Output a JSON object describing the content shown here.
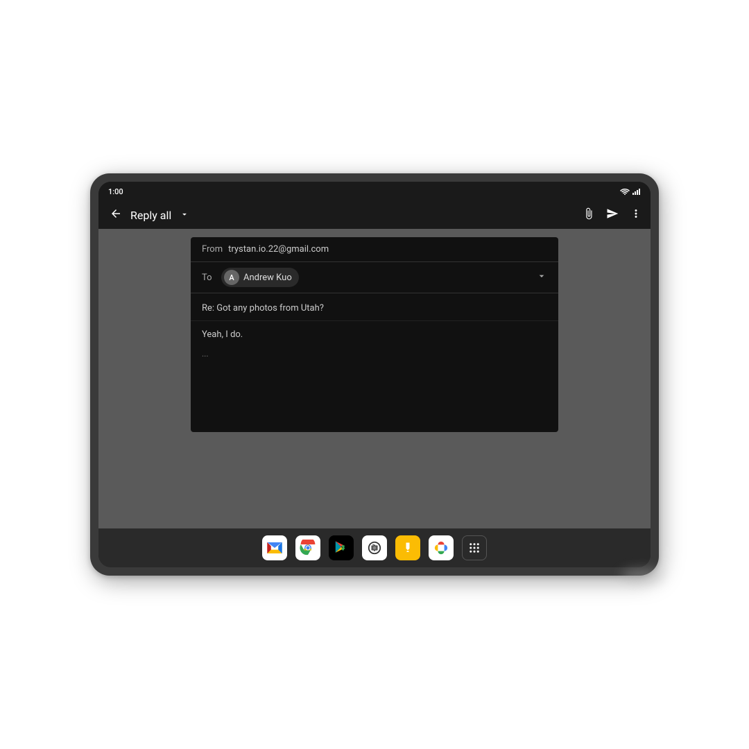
{
  "status_bar": {
    "time": "1:00",
    "wifi_icon": "wifi",
    "signal_icon": "signal"
  },
  "action_bar": {
    "back_label": "←",
    "reply_all_label": "Reply all",
    "dropdown_label": "▾",
    "attach_icon": "attach",
    "send_icon": "send",
    "more_icon": "more"
  },
  "email": {
    "from_label": "From",
    "from_value": "trystan.io.22@gmail.com",
    "to_label": "To",
    "recipient_avatar": "A",
    "recipient_name": "Andrew Kuo",
    "subject": "Re: Got any photos from Utah?",
    "body": "Yeah, I do.",
    "ellipsis": "..."
  },
  "taskbar": {
    "apps": [
      {
        "name": "gmail",
        "label": "Gmail"
      },
      {
        "name": "chrome",
        "label": "Chrome"
      },
      {
        "name": "play",
        "label": "Play Store"
      },
      {
        "name": "camera",
        "label": "Camera"
      },
      {
        "name": "keep",
        "label": "Keep"
      },
      {
        "name": "photos",
        "label": "Photos"
      },
      {
        "name": "apps",
        "label": "All Apps"
      }
    ]
  }
}
